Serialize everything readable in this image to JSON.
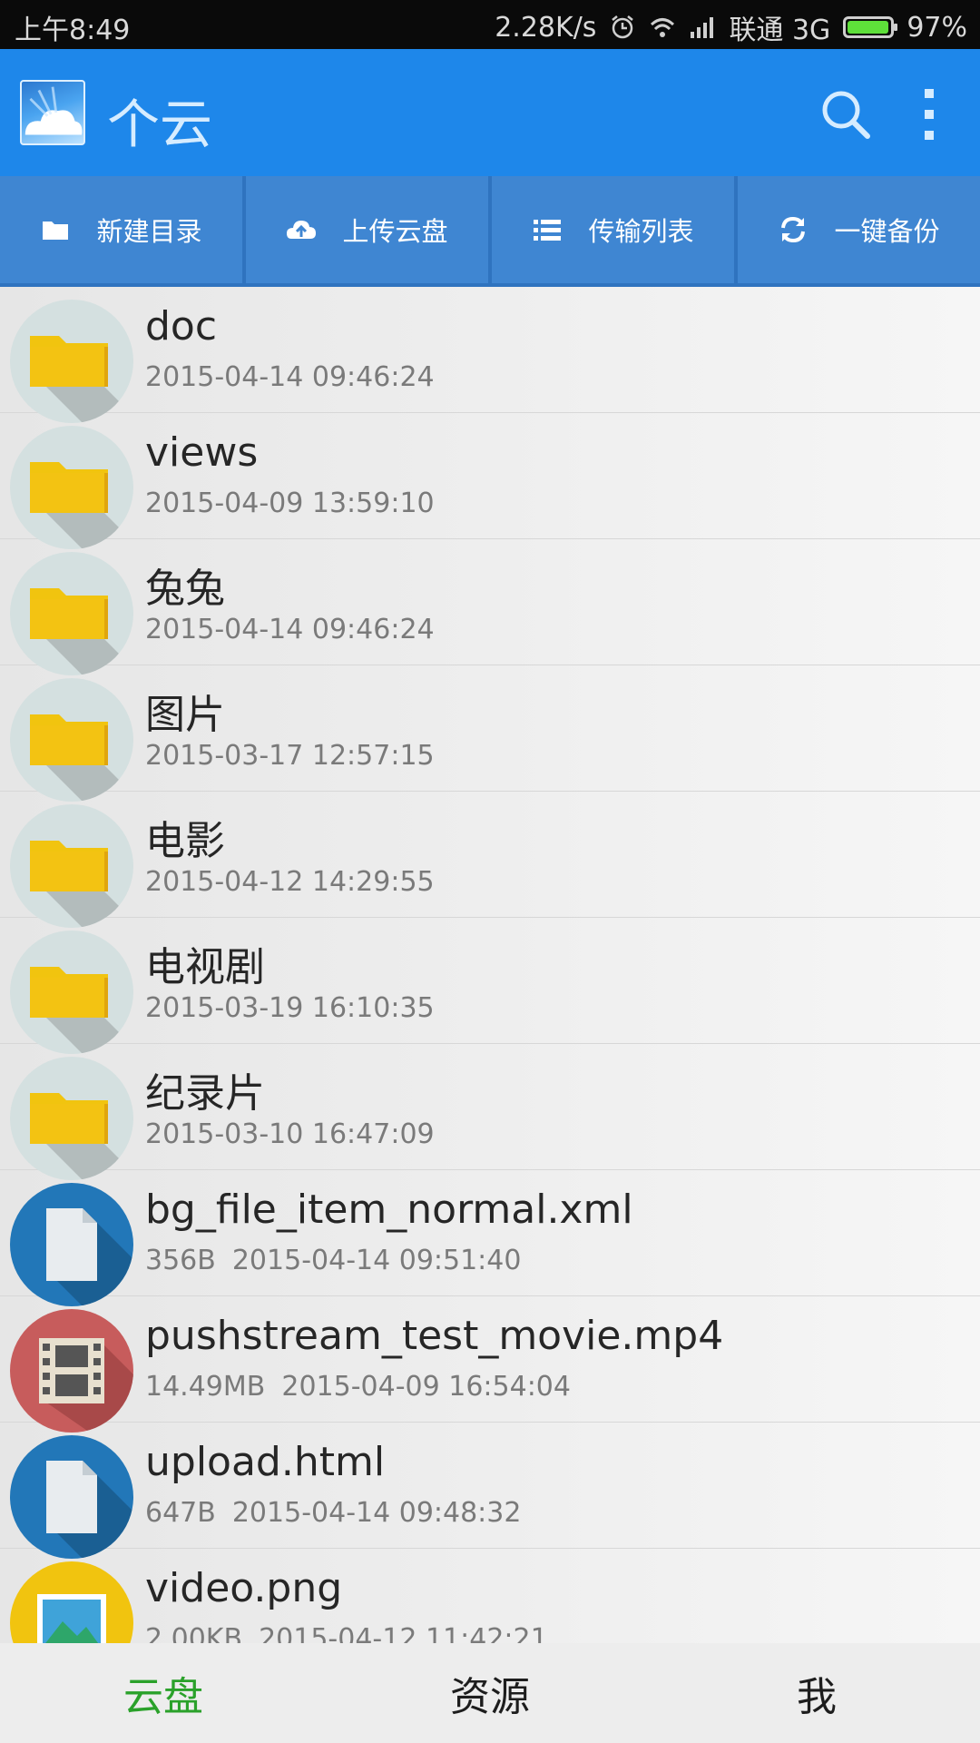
{
  "status_bar": {
    "time": "上午8:49",
    "speed": "2.28K/s",
    "carrier": "联通 3G",
    "battery": "97%",
    "battery_level": 0.97
  },
  "app_bar": {
    "title": "个云",
    "icons": [
      "cloud-logo-icon",
      "search-icon",
      "more-vert-icon"
    ]
  },
  "toolbar": {
    "buttons": [
      {
        "label": "新建目录",
        "icon": "folder-icon"
      },
      {
        "label": "上传云盘",
        "icon": "cloud-upload-icon"
      },
      {
        "label": "传输列表",
        "icon": "list-icon"
      },
      {
        "label": "一键备份",
        "icon": "sync-icon"
      }
    ]
  },
  "files": [
    {
      "name": "doc",
      "size": "",
      "date": "2015-04-14 09:46:24",
      "type": "folder"
    },
    {
      "name": "views",
      "size": "",
      "date": "2015-04-09 13:59:10",
      "type": "folder"
    },
    {
      "name": "兔兔",
      "size": "",
      "date": "2015-04-14 09:46:24",
      "type": "folder"
    },
    {
      "name": "图片",
      "size": "",
      "date": "2015-03-17 12:57:15",
      "type": "folder"
    },
    {
      "name": "电影",
      "size": "",
      "date": "2015-04-12 14:29:55",
      "type": "folder"
    },
    {
      "name": "电视剧",
      "size": "",
      "date": "2015-03-19 16:10:35",
      "type": "folder"
    },
    {
      "name": "纪录片",
      "size": "",
      "date": "2015-03-10 16:47:09",
      "type": "folder"
    },
    {
      "name": "bg_file_item_normal.xml",
      "size": "356B",
      "date": "2015-04-14 09:51:40",
      "type": "file"
    },
    {
      "name": "pushstream_test_movie.mp4",
      "size": "14.49MB",
      "date": "2015-04-09 16:54:04",
      "type": "video"
    },
    {
      "name": "upload.html",
      "size": "647B",
      "date": "2015-04-14 09:48:32",
      "type": "file"
    },
    {
      "name": "video.png",
      "size": "2.00KB",
      "date": "2015-04-12 11:42:21",
      "type": "image"
    }
  ],
  "bottom_nav": {
    "tabs": [
      {
        "label": "云盘",
        "active": true
      },
      {
        "label": "资源",
        "active": false
      },
      {
        "label": "我",
        "active": false
      }
    ]
  },
  "colors": {
    "app_bar": "#1e87ea",
    "toolbar": "#3f86d2",
    "folder": "#f1c40f",
    "file_circle": "#2277b8",
    "video_circle": "#c75c5c",
    "image_circle": "#f1c40f",
    "active_tab": "#2aa12a"
  }
}
